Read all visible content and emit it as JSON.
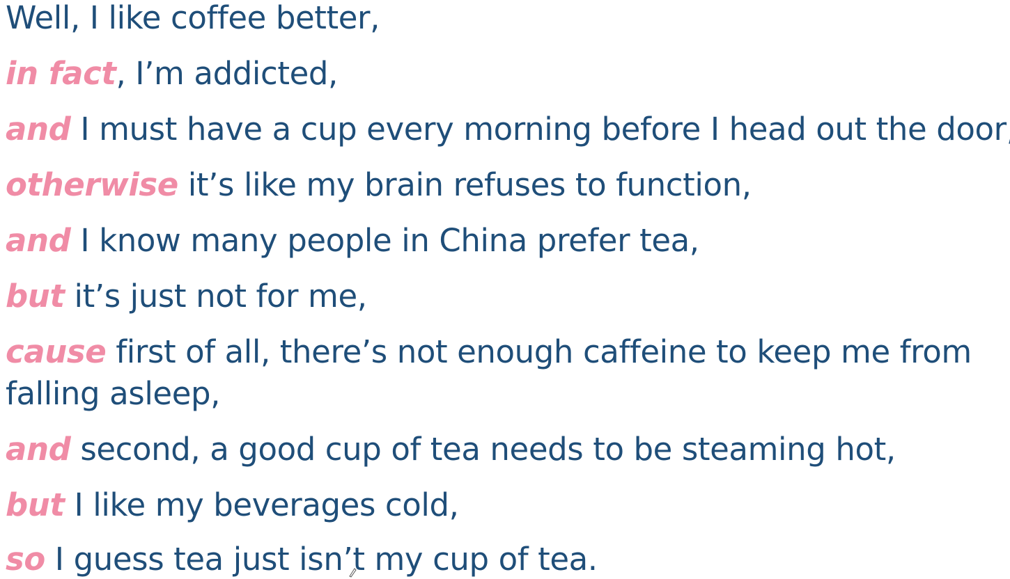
{
  "lines": [
    {
      "connector": "",
      "text": "Well, I like coffee better,"
    },
    {
      "connector": "in fact",
      "text": ", I’m addicted,"
    },
    {
      "connector": "and",
      "text": " I must have a cup every morning before I head out the door,"
    },
    {
      "connector": "otherwise",
      "text": " it’s like my brain refuses to function,"
    },
    {
      "connector": "and",
      "text": " I know many people in China prefer tea,"
    },
    {
      "connector": "but",
      "text": " it’s just not for me,"
    },
    {
      "connector": "cause",
      "text": " first of all, there’s not enough caffeine to keep me from",
      "continuation": "falling asleep,"
    },
    {
      "connector": "and",
      "text": " second, a good cup of tea needs to be steaming hot,"
    },
    {
      "connector": "but",
      "text": " I like my beverages cold,"
    },
    {
      "connector": "so",
      "text": " I guess tea just isn’t my cup of tea."
    }
  ],
  "colors": {
    "text": "#1f4e79",
    "connector": "#f08ca6"
  }
}
